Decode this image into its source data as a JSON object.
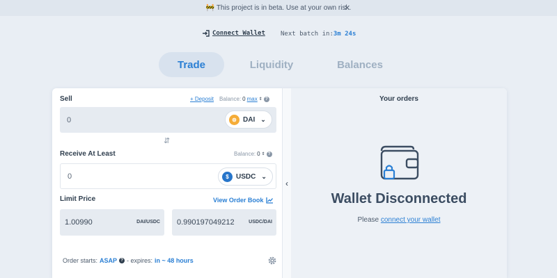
{
  "banner": {
    "text": "🚧 This project is in beta. Use at your own risk.",
    "close": "✕"
  },
  "top": {
    "connect_label": "Connect Wallet",
    "batch_label": "Next batch in:",
    "batch_time": "3m 24s"
  },
  "tabs": [
    {
      "label": "Trade",
      "active": true
    },
    {
      "label": "Liquidity",
      "active": false
    },
    {
      "label": "Balances",
      "active": false
    }
  ],
  "sell": {
    "label": "Sell",
    "deposit": "+ Deposit",
    "balance_label": "Balance:",
    "balance_value": "0",
    "max": "max",
    "amount": "0",
    "token": "DAI",
    "token_icon": "dai-coin-icon",
    "token_color": "#f5ac37"
  },
  "receive": {
    "label": "Receive At Least",
    "balance_label": "Balance:",
    "balance_value": "0",
    "amount": "0",
    "token": "USDC",
    "token_icon": "usdc-coin-icon",
    "token_color": "#2775ca"
  },
  "limit": {
    "label": "Limit Price",
    "view_order_book": "View Order Book",
    "price1": "1.00990",
    "unit1": "DAI/USDC",
    "price2": "0.990197049212",
    "unit2": "USDC/DAI"
  },
  "order": {
    "starts_label": "Order starts:",
    "starts_value": "ASAP",
    "expires_label": "- expires:",
    "expires_value": "in ~ 48 hours"
  },
  "orders_panel": {
    "title": "Your orders",
    "status": "Wallet Disconnected",
    "please": "Please",
    "connect_link": "connect your wallet"
  },
  "colors": {
    "accent": "#2a7fd4",
    "background": "#e9eef4",
    "panel": "#edf1f6"
  }
}
